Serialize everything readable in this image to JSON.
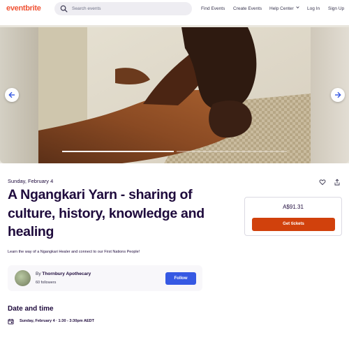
{
  "header": {
    "logo": "eventbrite",
    "search_placeholder": "Search events",
    "nav": {
      "find_events": "Find Events",
      "create_events": "Create Events",
      "help_center": "Help Center",
      "log_in": "Log In",
      "sign_up": "Sign Up"
    }
  },
  "hero": {
    "carousel_slides": 2,
    "active_slide": 1
  },
  "event": {
    "date": "Sunday, February 4",
    "title": "A Ngangkari Yarn - sharing of culture, history, knowledge and healing",
    "summary": "Learn the way of a Ngangkari Healer and connect to our First Nations People!"
  },
  "organizer": {
    "by_prefix": "By",
    "name": "Thornbury Apothecary",
    "followers": "60 followers",
    "follow_label": "Follow"
  },
  "date_time": {
    "heading": "Date and time",
    "value": "Sunday, February 4 · 1:30 - 3:30pm AEDT"
  },
  "tickets": {
    "price": "A$91.31",
    "button_label": "Get tickets"
  },
  "colors": {
    "brand": "#f05537",
    "primary_text": "#1e0a3c",
    "follow_button": "#3659e3",
    "tickets_button": "#d1410c"
  }
}
